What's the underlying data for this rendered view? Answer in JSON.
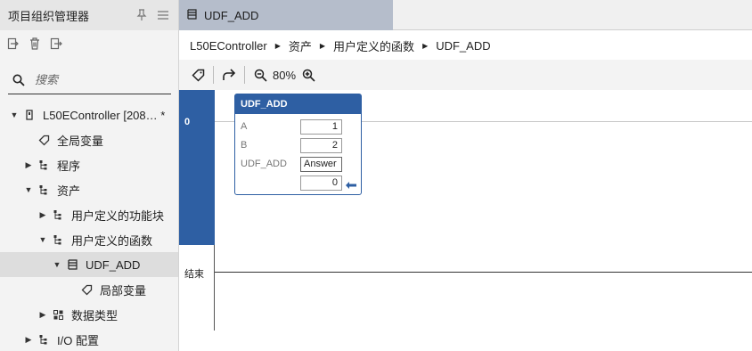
{
  "left_panel": {
    "title": "项目组织管理器",
    "search": {
      "placeholder": "搜索",
      "value": ""
    }
  },
  "tree": {
    "items": [
      {
        "label": "L50EController [208… *",
        "level": 0,
        "caret": "▼",
        "icon": "controller-icon"
      },
      {
        "label": "全局变量",
        "level": 1,
        "caret": "",
        "icon": "tag-icon"
      },
      {
        "label": "程序",
        "level": 1,
        "caret": "▶",
        "icon": "tree-node-icon"
      },
      {
        "label": "资产",
        "level": 1,
        "caret": "▼",
        "icon": "tree-node-icon"
      },
      {
        "label": "用户定义的功能块",
        "level": 2,
        "caret": "▶",
        "icon": "tree-node-icon"
      },
      {
        "label": "用户定义的函数",
        "level": 2,
        "caret": "▼",
        "icon": "tree-node-icon"
      },
      {
        "label": "UDF_ADD",
        "level": 3,
        "caret": "▼",
        "icon": "function-icon",
        "selected": true
      },
      {
        "label": "局部变量",
        "level": 4,
        "caret": "",
        "icon": "tag-icon"
      },
      {
        "label": "数据类型",
        "level": 2,
        "caret": "▶",
        "icon": "datatype-icon"
      },
      {
        "label": "I/O 配置",
        "level": 1,
        "caret": "▶",
        "icon": "tree-node-icon"
      }
    ]
  },
  "tab": {
    "label": "UDF_ADD"
  },
  "breadcrumb": [
    "L50EController",
    "资产",
    "用户定义的函数",
    "UDF_ADD"
  ],
  "editor_toolbar": {
    "zoom": "80%"
  },
  "ladder": {
    "rung_number": "0",
    "end_label": "结束",
    "block": {
      "title": "UDF_ADD",
      "params": [
        {
          "name": "A",
          "value": "1"
        },
        {
          "name": "B",
          "value": "2"
        },
        {
          "name": "UDF_ADD",
          "value": "Answer"
        },
        {
          "name": "",
          "value": "0"
        }
      ]
    }
  },
  "colors": {
    "accent": "#2e5fa3",
    "tab_active": "#b5bdcb",
    "panel_bg": "#f3f3f3"
  }
}
